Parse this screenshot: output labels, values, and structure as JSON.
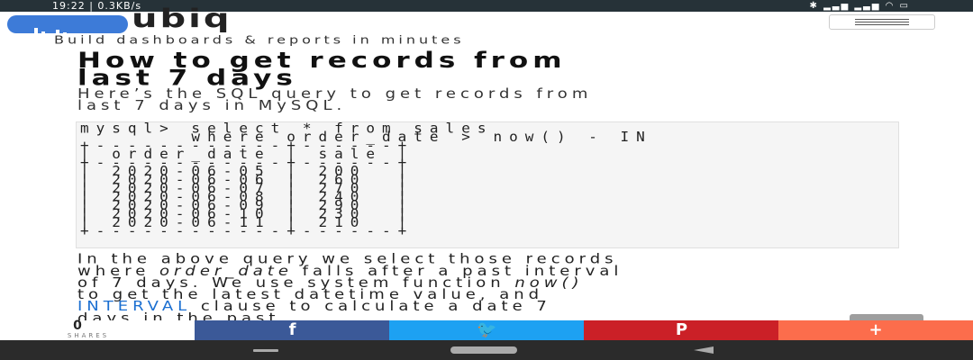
{
  "status_bar": {
    "time": "19:22 | 0.3KB/s",
    "icons": [
      "bluetooth-icon",
      "signal-icon",
      "signal-icon",
      "wifi-icon",
      "battery-icon"
    ]
  },
  "header": {
    "logo_text": "ubiq",
    "tagline": "Build dashboards & reports in minutes",
    "menu_icon": "hamburger-icon"
  },
  "article": {
    "title_line1": "How to get records from",
    "title_line2": "last 7 days",
    "intro_line1": "Here’s the SQL query to get records from",
    "intro_line2": "last 7 days in MySQL.",
    "code": {
      "line1": "mysql> select * from sales",
      "line2": "       where order_date > now() - IN",
      "border": "+------------+------+",
      "col1_header": "order_date",
      "col2_header": "sale",
      "rows": [
        {
          "order_date": "2020-06-05",
          "sale": "200"
        },
        {
          "order_date": "2020-06-06",
          "sale": "260"
        },
        {
          "order_date": "2020-06-07",
          "sale": "270"
        },
        {
          "order_date": "2020-06-08",
          "sale": "240"
        },
        {
          "order_date": "2020-06-09",
          "sale": "290"
        },
        {
          "order_date": "2020-06-10",
          "sale": "230"
        },
        {
          "order_date": "2020-06-11",
          "sale": "210"
        }
      ]
    },
    "body": {
      "l1": "In the above query we select those records",
      "l2a": "where ",
      "l2em": "order_date",
      "l2b": " falls after a past interval",
      "l3a": "of 7 days. We use system function ",
      "l3em": "now()",
      "l4": "to get the latest datetime value, and",
      "l5link": "INTERVAL",
      "l5b": " clause to calculate a date 7",
      "l6": "days in the past."
    }
  },
  "share_bar": {
    "count": "0",
    "label": "SHARES",
    "facebook_glyph": "f",
    "twitter_glyph": "🐦",
    "pinterest_glyph": "P",
    "plus_glyph": "+"
  },
  "colors": {
    "status_bar": "#263238",
    "logo": "#3d7bd8",
    "link": "#1b6fd1",
    "facebook": "#3b5998",
    "twitter": "#1da1f2",
    "pinterest": "#cb2027",
    "more": "#fc6d4c",
    "nav_bar": "#2b2b2b"
  }
}
